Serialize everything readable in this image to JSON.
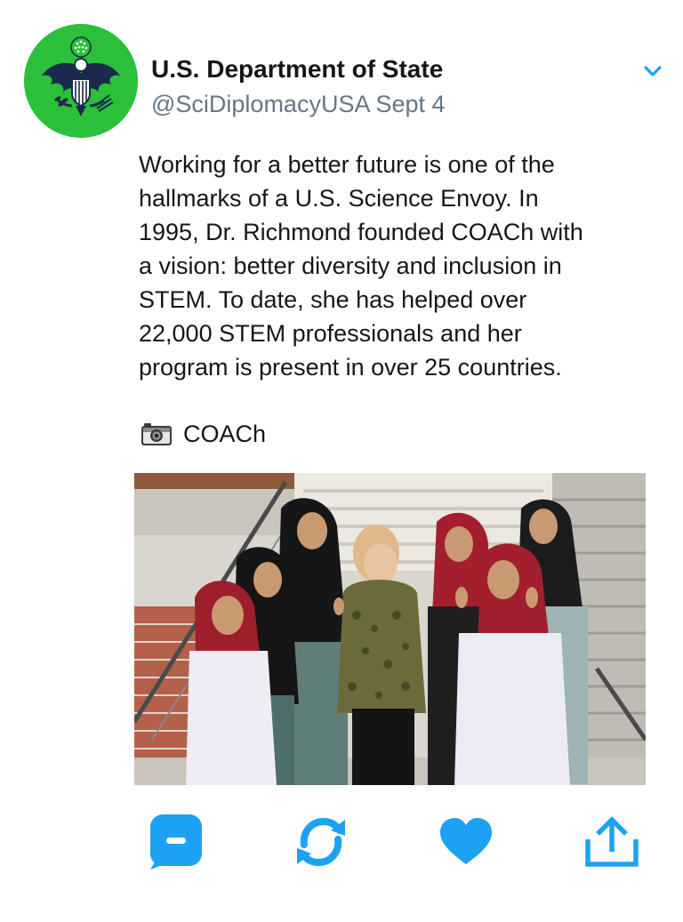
{
  "tweet": {
    "display_name": "U.S. Department of State",
    "handle": "@SciDiplomacyUSA",
    "date": "Sept 4",
    "text_lines": [
      "Working for a better future is one of the",
      "hallmarks of a U.S. Science Envoy. In",
      "1995, Dr. Richmond founded COACh with",
      "a vision: better diversity and inclusion in",
      "STEM. To date, she has helped over",
      "22,000 STEM professionals and her",
      "program is present in over 25 countries."
    ],
    "photo_credit": "COACh",
    "avatar_icon": "state-department-seal",
    "avatar_color": "#2bbf3a"
  },
  "actions": {
    "icons": [
      "reply-icon",
      "retweet-icon",
      "like-icon",
      "share-icon"
    ],
    "accent_color": "#1da1f2"
  },
  "colors": {
    "text": "#14171a",
    "secondary": "#657786"
  }
}
